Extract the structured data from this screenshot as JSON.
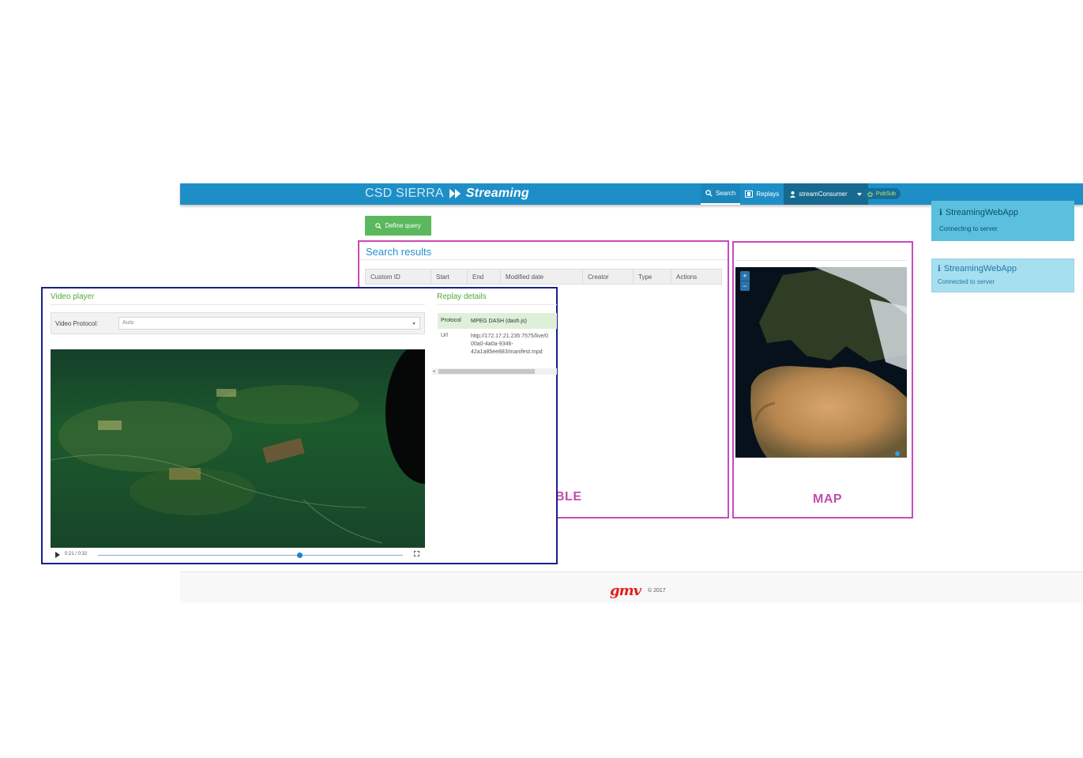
{
  "header": {
    "brand_primary": "CSD SIERRA",
    "brand_secondary": "Streaming",
    "nav": {
      "search": "Search",
      "replays": "Replays",
      "user": "streamConsumer",
      "pubsub": "PubSub"
    }
  },
  "toolbar": {
    "define_query": "Define query"
  },
  "search_results": {
    "title": "Search results",
    "columns": [
      "Custom ID",
      "Start",
      "End",
      "Modified date",
      "Creator",
      "Type",
      "Actions"
    ],
    "annotation": "BLE"
  },
  "map": {
    "annotation": "MAP",
    "zoom_in": "+",
    "zoom_out": "−"
  },
  "notifications": [
    {
      "title": "StreamingWebApp",
      "message": "Connecting to server"
    },
    {
      "title": "StreamingWebApp",
      "message": "Connected to server"
    }
  ],
  "video_player": {
    "title": "Video player",
    "protocol_label": "Video Protocol:",
    "protocol_value": "Auto",
    "time": "0:21 / 0:32",
    "progress_fraction": 0.66
  },
  "replay_details": {
    "title": "Replay details",
    "protocol_key": "Protocol",
    "protocol_value": "MPEG DASH (dash.js)",
    "url_key": "Url",
    "url_value_lines": [
      "http://172.17.21.235:7575/live/0",
      "00a0-4a0a-9346-",
      "42a1a85ee883/manifest.mpd"
    ]
  },
  "footer": {
    "logo": "gmv",
    "copyright": "© 2017"
  },
  "colors": {
    "topbar": "#1e8fc6",
    "accent_green": "#5cb85c",
    "annotation": "#c94ab7",
    "panel_border": "#1a1f8c"
  }
}
